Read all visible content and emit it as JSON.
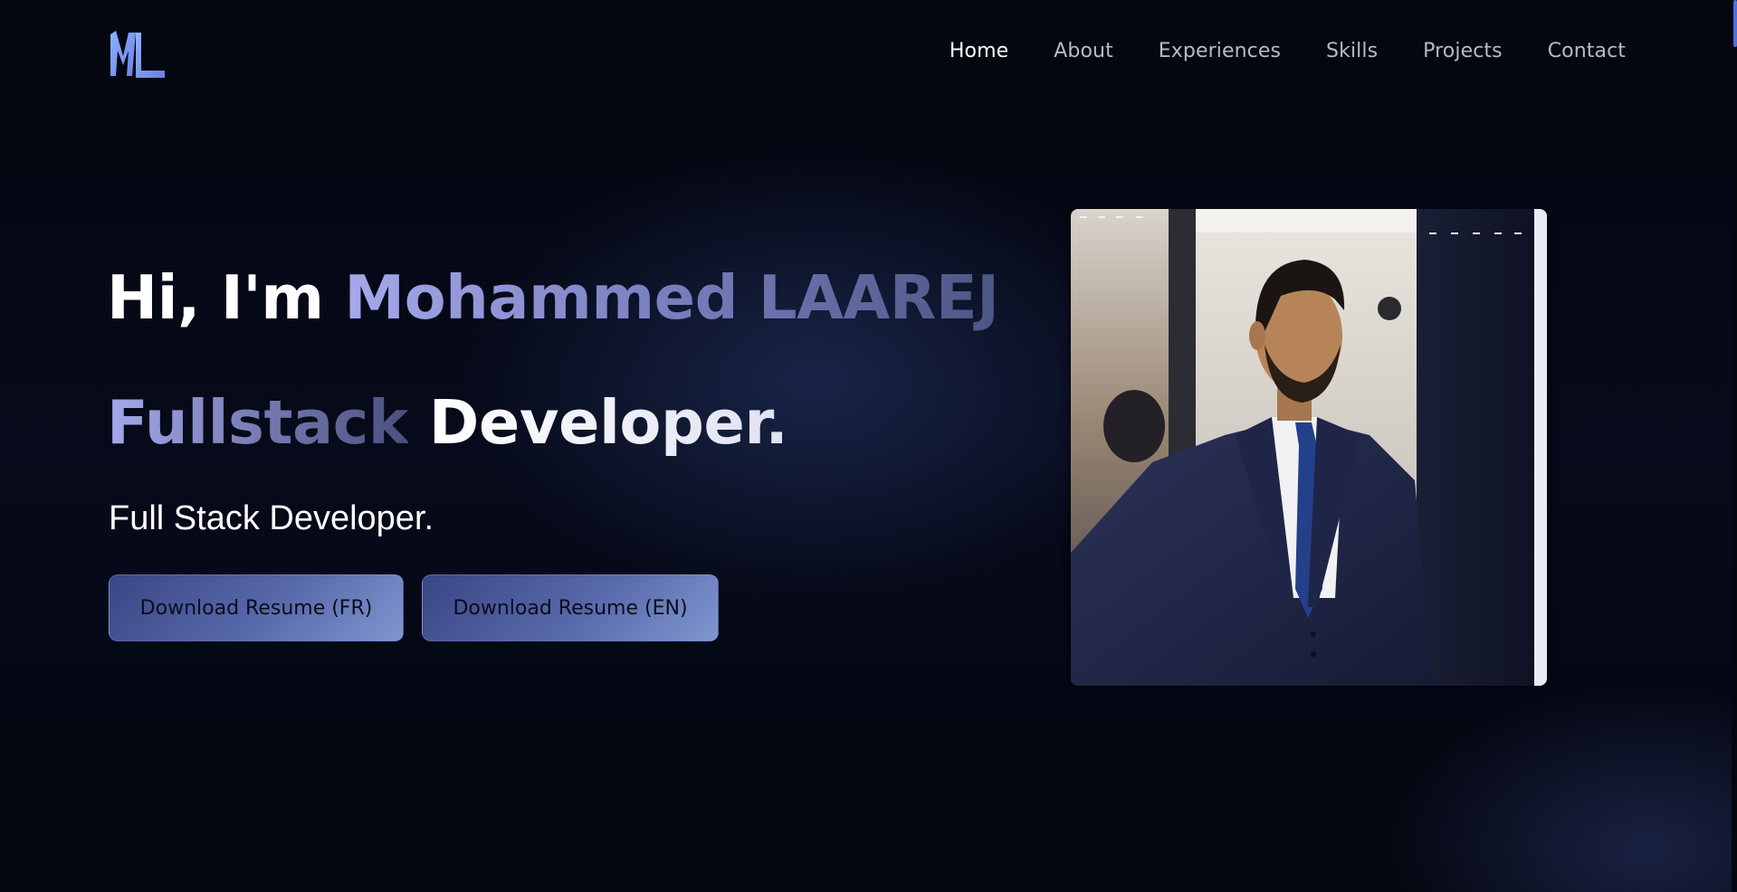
{
  "brand": {
    "logo_text": "ML",
    "accent_from": "#8ab4ff",
    "accent_to": "#6e7ce8"
  },
  "nav": {
    "items": [
      {
        "label": "Home",
        "active": true
      },
      {
        "label": "About",
        "active": false
      },
      {
        "label": "Experiences",
        "active": false
      },
      {
        "label": "Skills",
        "active": false
      },
      {
        "label": "Projects",
        "active": false
      },
      {
        "label": "Contact",
        "active": false
      }
    ]
  },
  "hero": {
    "greeting": "Hi, I'm",
    "name": "Mohammed LAAREJ",
    "role_highlight": "Fullstack",
    "role_rest": "Developer.",
    "subtitle": "Full Stack Developer."
  },
  "buttons": {
    "resume_fr": "Download Resume (FR)",
    "resume_en": "Download Resume (EN)"
  },
  "colors": {
    "background": "#04060f",
    "button_gradient_start": "#3a4685",
    "button_gradient_end": "#7f97d0"
  },
  "photo": {
    "subject": "portrait-photo"
  }
}
